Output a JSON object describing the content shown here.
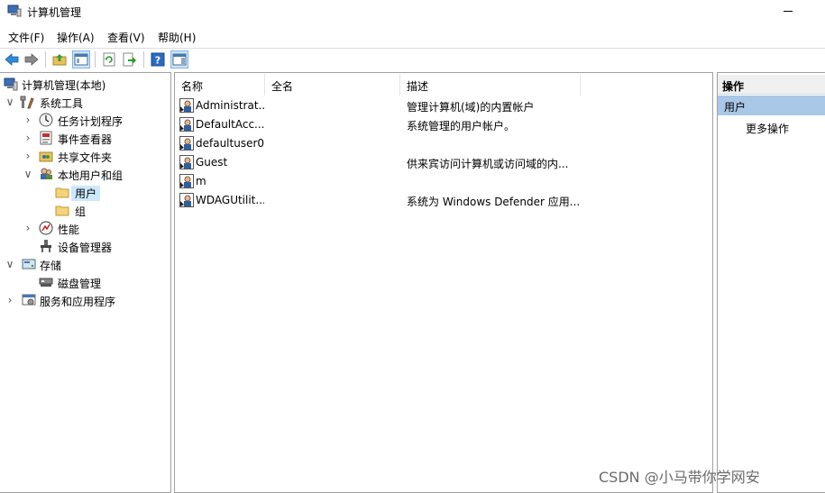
{
  "window": {
    "title": "计算机管理"
  },
  "menu": [
    "文件(F)",
    "操作(A)",
    "查看(V)",
    "帮助(H)"
  ],
  "toolbar": {
    "buttons": [
      "back-icon",
      "forward-icon",
      "up-folder-icon",
      "show-hide-tree-icon",
      "refresh-icon",
      "export-list-icon",
      "help-icon",
      "action-pane-icon"
    ]
  },
  "tree": {
    "root": "计算机管理(本地)",
    "system_tools": "系统工具",
    "task_scheduler": "任务计划程序",
    "event_viewer": "事件查看器",
    "shared_folders": "共享文件夹",
    "local_users_groups": "本地用户和组",
    "users": "用户",
    "groups": "组",
    "performance": "性能",
    "device_manager": "设备管理器",
    "storage": "存储",
    "disk_management": "磁盘管理",
    "services_apps": "服务和应用程序"
  },
  "list": {
    "columns": {
      "name": "名称",
      "fullname": "全名",
      "description": "描述"
    },
    "rows": [
      {
        "name": "Administrat...",
        "fullname": "",
        "description": "管理计算机(域)的内置帐户"
      },
      {
        "name": "DefaultAcc...",
        "fullname": "",
        "description": "系统管理的用户帐户。"
      },
      {
        "name": "defaultuser0",
        "fullname": "",
        "description": ""
      },
      {
        "name": "Guest",
        "fullname": "",
        "description": "供来宾访问计算机或访问域的内..."
      },
      {
        "name": "m",
        "fullname": "",
        "description": ""
      },
      {
        "name": "WDAGUtilit...",
        "fullname": "",
        "description": "系统为 Windows Defender 应用..."
      }
    ]
  },
  "actions": {
    "header": "操作",
    "section": "用户",
    "more": "更多操作"
  },
  "watermark": "CSDN @小马带你学网安",
  "colors": {
    "selection": "#cce8ff",
    "action_section": "#a9c7e6",
    "accent_blue": "#2b6cc4"
  }
}
